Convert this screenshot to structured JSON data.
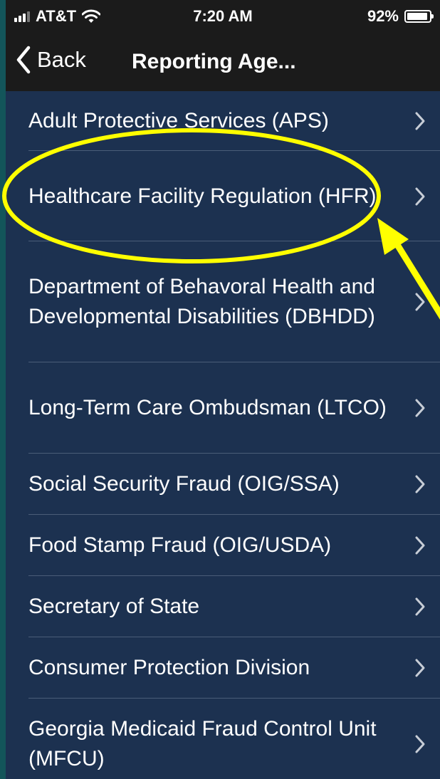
{
  "status_bar": {
    "carrier": "AT&T",
    "time": "7:20 AM",
    "battery": "92%",
    "battery_level": 0.92
  },
  "nav": {
    "back_label": "Back",
    "title": "Reporting Age..."
  },
  "list": [
    {
      "label": "Adult Protective Services (APS)"
    },
    {
      "label": "Healthcare Facility Regulation (HFR)"
    },
    {
      "label": "Department of Behavoral Health and Developmental Disabilities (DBHDD)"
    },
    {
      "label": "Long-Term Care Ombudsman (LTCO)"
    },
    {
      "label": "Social Security Fraud (OIG/SSA)"
    },
    {
      "label": "Food Stamp Fraud (OIG/USDA)"
    },
    {
      "label": "Secretary of State"
    },
    {
      "label": "Consumer Protection Division"
    },
    {
      "label": "Georgia Medicaid Fraud Control Unit (MFCU)"
    }
  ],
  "annotation": {
    "highlight_color": "#ffff00"
  },
  "icons": {
    "back": "chevron-left-icon",
    "row": "chevron-right-icon"
  }
}
